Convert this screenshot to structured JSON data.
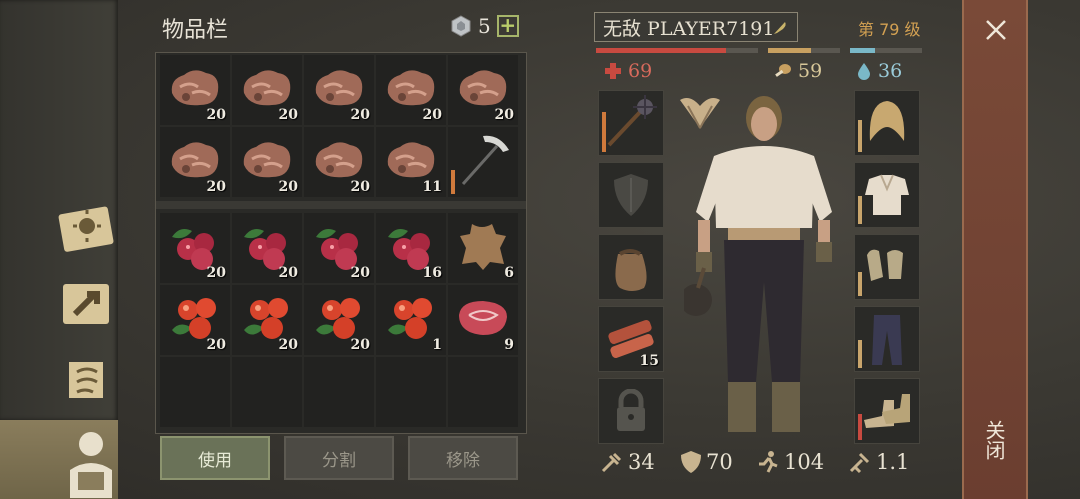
{
  "inventory": {
    "title": "物品栏",
    "gem_count": "5",
    "plus_label": "+",
    "rows": [
      [
        {
          "icon": "iron-ore-icon",
          "count": "20"
        },
        {
          "icon": "iron-ore-icon",
          "count": "20"
        },
        {
          "icon": "iron-ore-icon",
          "count": "20"
        },
        {
          "icon": "iron-ore-icon",
          "count": "20"
        },
        {
          "icon": "iron-ore-icon",
          "count": "20"
        }
      ],
      [
        {
          "icon": "iron-ore-icon",
          "count": "20"
        },
        {
          "icon": "iron-ore-icon",
          "count": "20"
        },
        {
          "icon": "iron-ore-icon",
          "count": "20"
        },
        {
          "icon": "iron-ore-icon",
          "count": "11"
        },
        {
          "icon": "pickaxe-icon",
          "count": ""
        }
      ],
      [
        {
          "icon": "lingonberry-icon",
          "count": "20"
        },
        {
          "icon": "lingonberry-icon",
          "count": "20"
        },
        {
          "icon": "lingonberry-icon",
          "count": "20"
        },
        {
          "icon": "lingonberry-icon",
          "count": "16"
        },
        {
          "icon": "animal-hide-icon",
          "count": "6"
        }
      ],
      [
        {
          "icon": "rosehip-icon",
          "count": "20"
        },
        {
          "icon": "rosehip-icon",
          "count": "20"
        },
        {
          "icon": "rosehip-icon",
          "count": "20"
        },
        {
          "icon": "rosehip-icon",
          "count": "1"
        },
        {
          "icon": "raw-meat-icon",
          "count": "9"
        }
      ]
    ],
    "buttons": {
      "use": "使用",
      "split": "分割",
      "remove": "移除"
    }
  },
  "character": {
    "name": "无敌 PLAYER7191",
    "level": "第 79 级",
    "health": "69",
    "hunger": "59",
    "thirst": "36",
    "health_pct": 0.8,
    "hunger_pct": 0.6,
    "thirst_pct": 0.35,
    "bag_count": "15",
    "attack": "34",
    "armor": "70",
    "speed": "104",
    "weight": "1.1"
  },
  "close": {
    "label": "关闭"
  },
  "colors": {
    "health": "#c84a40",
    "hunger": "#c8a060",
    "thirst": "#7ab8c8",
    "level": "#d2a052"
  }
}
